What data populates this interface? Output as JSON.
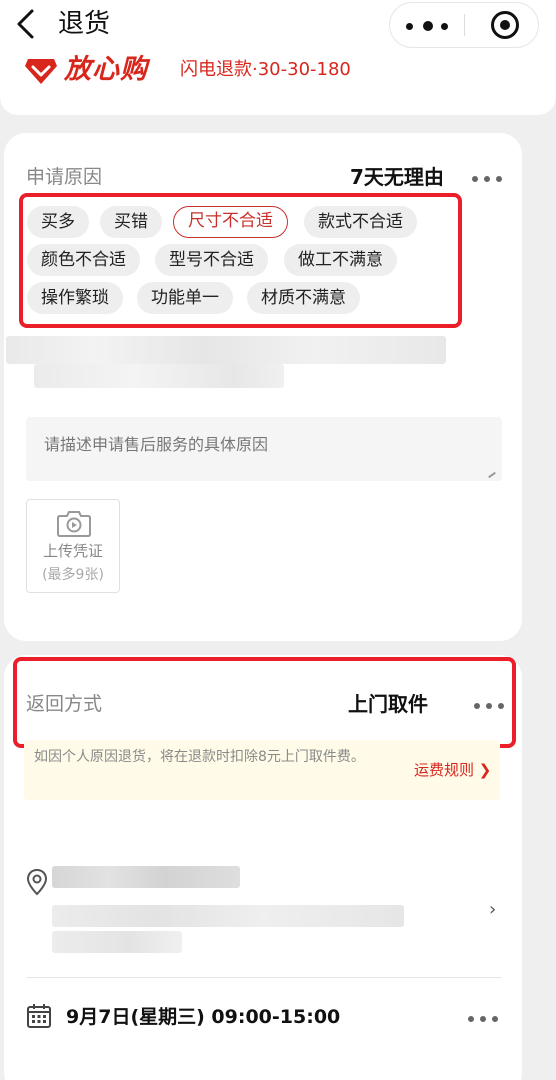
{
  "header": {
    "title": "退货",
    "capsule": {
      "more_icon": "more-icon",
      "close_icon": "mini-program-close-icon"
    }
  },
  "brand": {
    "logo_icon": "diamond-logo-icon",
    "name": "放心购",
    "service": "闪电退款·30-30-180",
    "color": "#d8261d"
  },
  "reason": {
    "label": "申请原因",
    "value": "7天无理由",
    "chips": [
      {
        "label": "买多",
        "selected": false
      },
      {
        "label": "买错",
        "selected": false
      },
      {
        "label": "尺寸不合适",
        "selected": true
      },
      {
        "label": "款式不合适",
        "selected": false
      },
      {
        "label": "颜色不合适",
        "selected": false
      },
      {
        "label": "型号不合适",
        "selected": false
      },
      {
        "label": "做工不满意",
        "selected": false
      },
      {
        "label": "操作繁琐",
        "selected": false
      },
      {
        "label": "功能单一",
        "selected": false
      },
      {
        "label": "材质不满意",
        "selected": false
      }
    ],
    "description_placeholder": "请描述申请售后服务的具体原因",
    "upload_label": "上传凭证",
    "upload_limit": "(最多9张)"
  },
  "return_method": {
    "label": "返回方式",
    "value": "上门取件",
    "notice": "如因个人原因退货，将在退款时扣除8元上门取件费。",
    "fee_rule_link": "运费规则 ❯",
    "address_arrow": "›",
    "pickup_time": "9月7日(星期三) 09:00-15:00"
  },
  "colors": {
    "highlight_box": "#ea1f2a",
    "accent": "#d8261d"
  }
}
